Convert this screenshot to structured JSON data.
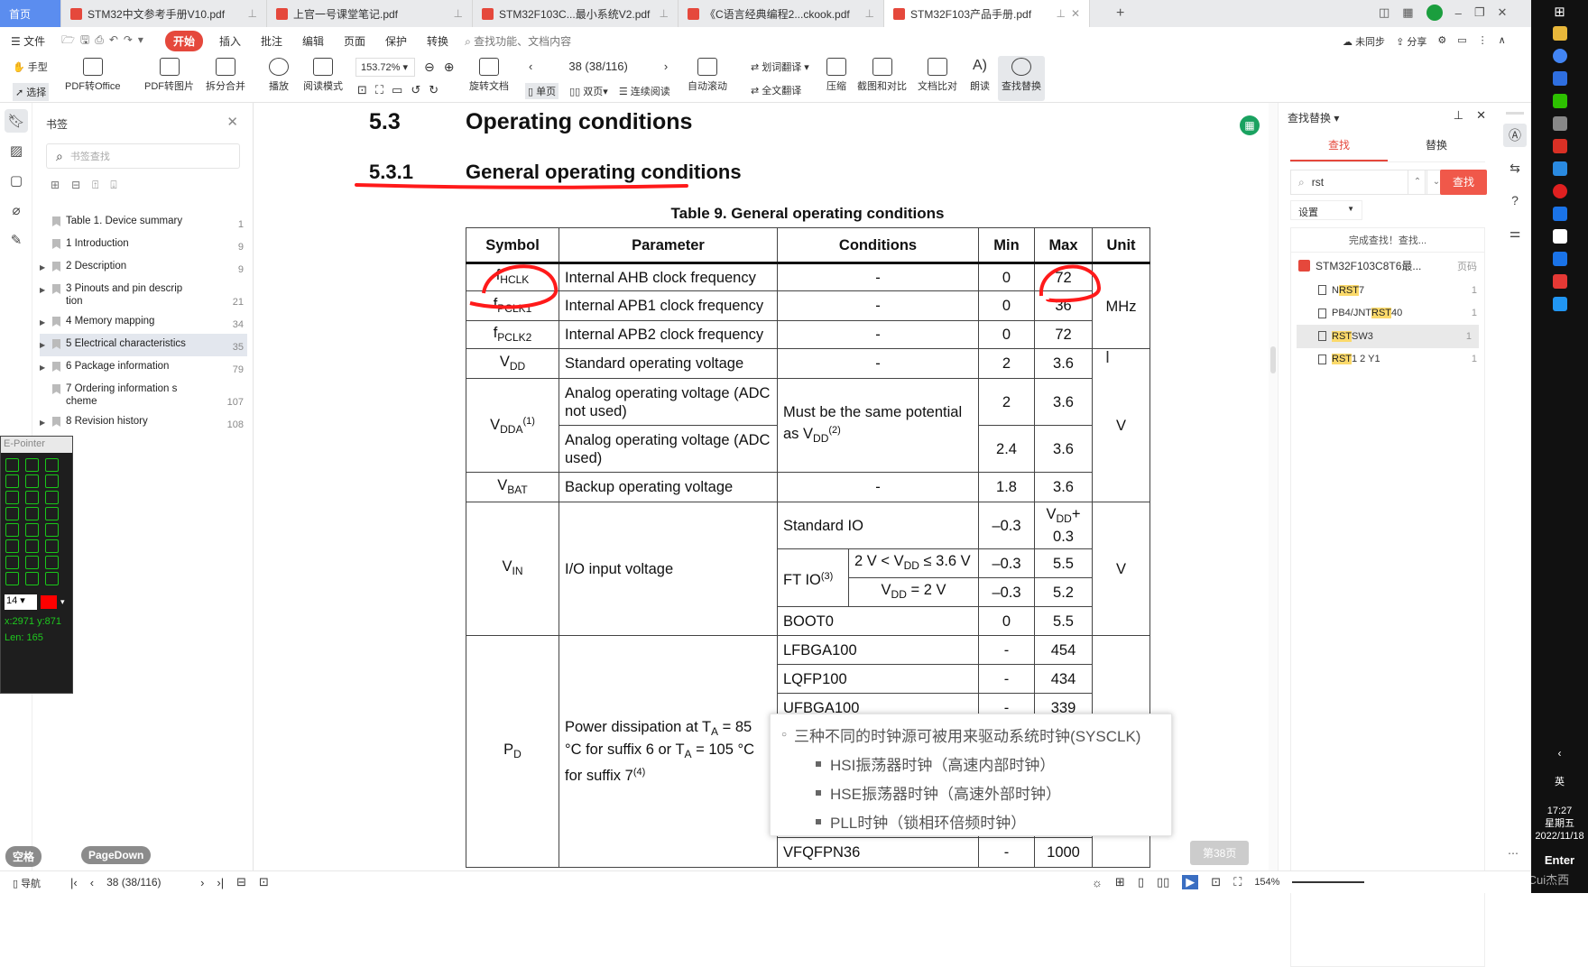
{
  "tabs": [
    {
      "label": "首页",
      "type": "home"
    },
    {
      "label": "STM32中文参考手册V10.pdf"
    },
    {
      "label": "上官一号课堂笔记.pdf"
    },
    {
      "label": "STM32F103C...最小系统V2.pdf"
    },
    {
      "label": "《C语言经典编程2...ckook.pdf"
    },
    {
      "label": "STM32F103产品手册.pdf",
      "active": true
    }
  ],
  "menu": {
    "file": "文件",
    "start": "开始",
    "items": [
      "插入",
      "批注",
      "编辑",
      "页面",
      "保护",
      "转换"
    ],
    "search_placeholder": "查找功能、文档内容",
    "sync": "未同步",
    "share": "分享"
  },
  "toolbar": {
    "hand": "手型",
    "select": "选择",
    "pdf_office": "PDF转Office",
    "pdf_image": "PDF转图片",
    "split_merge": "拆分合并",
    "play": "播放",
    "read_mode": "阅读模式",
    "zoom": "153.72%",
    "rotate": "旋转文档",
    "page": "38 (38/116)",
    "single": "单页",
    "double": "双页",
    "continuous": "连续阅读",
    "auto_scroll": "自动滚动",
    "word_translate": "划词翻译",
    "full_translate": "全文翻译",
    "compress": "压缩",
    "screenshot_compare": "截图和对比",
    "doc_compare": "文档比对",
    "read_aloud": "朗读",
    "find_replace": "查找替换"
  },
  "bookmarks": {
    "title": "书签",
    "search_placeholder": "书签查找",
    "items": [
      {
        "label": "Table 1. Device summary",
        "page": "1",
        "expandable": false
      },
      {
        "label": "1 Introduction",
        "page": "9",
        "expandable": false
      },
      {
        "label": "2 Description",
        "page": "9",
        "expandable": true
      },
      {
        "label": "3 Pinouts and pin descrip tion",
        "page": "21",
        "expandable": true
      },
      {
        "label": "4 Memory mapping",
        "page": "34",
        "expandable": true
      },
      {
        "label": "5 Electrical characteristics",
        "page": "35",
        "expandable": true,
        "selected": true
      },
      {
        "label": "6 Package information",
        "page": "79",
        "expandable": true
      },
      {
        "label": "7 Ordering information s cheme",
        "page": "107",
        "expandable": false
      },
      {
        "label": "8 Revision history",
        "page": "108",
        "expandable": true
      }
    ]
  },
  "epointer": {
    "title": "E-Pointer",
    "size": "14",
    "color": "#ff0000",
    "coords": "x:2971 y:871",
    "length": "Len: 165"
  },
  "keys": {
    "space": "空格",
    "pagedown": "PageDown"
  },
  "document": {
    "h1_num": "5.3",
    "h1": "Operating conditions",
    "h2_num": "5.3.1",
    "h2": "General operating conditions",
    "table_title": "Table 9. General operating conditions",
    "headers": [
      "Symbol",
      "Parameter",
      "Conditions",
      "Min",
      "Max",
      "Unit"
    ],
    "rows": [
      [
        {
          "p": [
            [
              "f"
            ],
            [
              "HCLK",
              "sub"
            ]
          ]
        },
        {
          "p": [
            [
              "Internal AHB clock frequency"
            ]
          ]
        },
        {
          "p": [
            [
              "-"
            ]
          ],
          "cs": 2,
          "c": 1
        },
        {
          "p": [
            [
              "0"
            ]
          ],
          "c": 1
        },
        {
          "p": [
            [
              "72"
            ]
          ],
          "c": 1
        },
        {
          "p": [
            [
              "MHz"
            ]
          ],
          "rs": 3,
          "c": 1
        }
      ],
      [
        {
          "p": [
            [
              "f"
            ],
            [
              "PCLK1",
              "sub"
            ]
          ]
        },
        {
          "p": [
            [
              "Internal APB1 clock frequency"
            ]
          ]
        },
        {
          "p": [
            [
              "-"
            ]
          ],
          "cs": 2,
          "c": 1
        },
        {
          "p": [
            [
              "0"
            ]
          ],
          "c": 1
        },
        {
          "p": [
            [
              "36"
            ]
          ],
          "c": 1
        }
      ],
      [
        {
          "p": [
            [
              "f"
            ],
            [
              "PCLK2",
              "sub"
            ]
          ]
        },
        {
          "p": [
            [
              "Internal APB2 clock frequency"
            ]
          ]
        },
        {
          "p": [
            [
              "-"
            ]
          ],
          "cs": 2,
          "c": 1
        },
        {
          "p": [
            [
              "0"
            ]
          ],
          "c": 1
        },
        {
          "p": [
            [
              "72"
            ]
          ],
          "c": 1
        }
      ],
      [
        {
          "p": [
            [
              "V"
            ],
            [
              "DD",
              "sub"
            ]
          ]
        },
        {
          "p": [
            [
              "Standard operating voltage"
            ]
          ]
        },
        {
          "p": [
            [
              "-"
            ]
          ],
          "cs": 2,
          "c": 1
        },
        {
          "p": [
            [
              "2"
            ]
          ],
          "c": 1
        },
        {
          "p": [
            [
              "3.6"
            ]
          ],
          "c": 1
        },
        {
          "p": [
            [
              "V"
            ]
          ],
          "rs": 4,
          "c": 1
        }
      ],
      [
        {
          "p": [
            [
              "V"
            ],
            [
              "DDA",
              "sub"
            ],
            [
              "(1)",
              "sup"
            ]
          ],
          "rs": 2
        },
        {
          "p": [
            [
              "Analog operating voltage (ADC not used)"
            ]
          ]
        },
        {
          "p": [
            [
              "Must be the same potential as V"
            ],
            [
              "DD",
              "sub"
            ],
            [
              "(2)",
              "sup"
            ]
          ],
          "cs": 2,
          "rs": 2
        },
        {
          "p": [
            [
              "2"
            ]
          ],
          "c": 1
        },
        {
          "p": [
            [
              "3.6"
            ]
          ],
          "c": 1
        }
      ],
      [
        {
          "p": [
            [
              "Analog operating voltage (ADC used)"
            ]
          ]
        },
        {
          "p": [
            [
              "2.4"
            ]
          ],
          "c": 1
        },
        {
          "p": [
            [
              "3.6"
            ]
          ],
          "c": 1
        }
      ],
      [
        {
          "p": [
            [
              "V"
            ],
            [
              "BAT",
              "sub"
            ]
          ]
        },
        {
          "p": [
            [
              "Backup operating voltage"
            ]
          ]
        },
        {
          "p": [
            [
              "-"
            ]
          ],
          "cs": 2,
          "c": 1
        },
        {
          "p": [
            [
              "1.8"
            ]
          ],
          "c": 1
        },
        {
          "p": [
            [
              "3.6"
            ]
          ],
          "c": 1
        }
      ],
      [
        {
          "p": [
            [
              "V"
            ],
            [
              "IN",
              "sub"
            ]
          ],
          "rs": 4
        },
        {
          "p": [
            [
              "I/O input voltage"
            ]
          ],
          "rs": 4
        },
        {
          "p": [
            [
              "Standard IO"
            ]
          ],
          "cs": 2
        },
        {
          "p": [
            [
              "–0.3"
            ]
          ],
          "c": 1
        },
        {
          "p": [
            [
              "V"
            ],
            [
              "DD",
              "sub"
            ],
            [
              "+ 0.3"
            ]
          ],
          "c": 1
        },
        {
          "p": [
            [
              "V"
            ]
          ],
          "rs": 4,
          "c": 1
        }
      ],
      [
        {
          "p": [
            [
              "FT IO"
            ],
            [
              "(3)",
              "sup"
            ]
          ],
          "rs": 2
        },
        {
          "p": [
            [
              "2 V < V"
            ],
            [
              "DD",
              "sub"
            ],
            [
              " ≤  3.6 V"
            ]
          ]
        },
        {
          "p": [
            [
              "–0.3"
            ]
          ],
          "c": 1
        },
        {
          "p": [
            [
              "5.5"
            ]
          ],
          "c": 1
        }
      ],
      [
        {
          "p": [
            [
              "V"
            ],
            [
              "DD",
              "sub"
            ],
            [
              " = 2 V"
            ]
          ]
        },
        {
          "p": [
            [
              "–0.3"
            ]
          ],
          "c": 1
        },
        {
          "p": [
            [
              "5.2"
            ]
          ],
          "c": 1
        }
      ],
      [
        {
          "p": [
            [
              "BOOT0"
            ]
          ],
          "cs": 2
        },
        {
          "p": [
            [
              "0"
            ]
          ],
          "c": 1
        },
        {
          "p": [
            [
              "5.5"
            ]
          ],
          "c": 1
        }
      ],
      [
        {
          "p": [
            [
              "P"
            ],
            [
              "D",
              "sub"
            ]
          ],
          "rs": 9
        },
        {
          "p": [
            [
              "Power dissipation at T"
            ],
            [
              "A",
              "sub"
            ],
            [
              " = 85 °C for suffix 6 or T"
            ],
            [
              "A",
              "sub"
            ],
            [
              " = 105 °C for suffix 7"
            ],
            [
              "(4)",
              "sup"
            ]
          ],
          "rs": 9
        },
        {
          "p": [
            [
              "LFBGA100"
            ]
          ],
          "cs": 2
        },
        {
          "p": [
            [
              "-"
            ]
          ],
          "c": 1
        },
        {
          "p": [
            [
              "454"
            ]
          ],
          "c": 1
        },
        {
          "p": [
            [
              ""
            ]
          ],
          "rs": 9
        }
      ],
      [
        {
          "p": [
            [
              "LQFP100"
            ]
          ],
          "cs": 2
        },
        {
          "p": [
            [
              "-"
            ]
          ],
          "c": 1
        },
        {
          "p": [
            [
              "434"
            ]
          ],
          "c": 1
        }
      ],
      [
        {
          "p": [
            [
              "UFBGA100"
            ]
          ],
          "cs": 2
        },
        {
          "p": [
            [
              "-"
            ]
          ],
          "c": 1
        },
        {
          "p": [
            [
              "339"
            ]
          ],
          "c": 1
        }
      ],
      [
        {
          "p": [
            [
              ""
            ]
          ],
          "cs": 2
        },
        {
          "p": [
            [
              ""
            ]
          ]
        },
        {
          "p": [
            [
              ""
            ]
          ]
        }
      ],
      [
        {
          "p": [
            [
              ""
            ]
          ],
          "cs": 2
        },
        {
          "p": [
            [
              ""
            ]
          ]
        },
        {
          "p": [
            [
              ""
            ]
          ]
        }
      ],
      [
        {
          "p": [
            [
              ""
            ]
          ],
          "cs": 2
        },
        {
          "p": [
            [
              ""
            ]
          ]
        },
        {
          "p": [
            [
              ""
            ]
          ]
        }
      ],
      [
        {
          "p": [
            [
              ""
            ]
          ],
          "cs": 2
        },
        {
          "p": [
            [
              ""
            ]
          ]
        },
        {
          "p": [
            [
              ""
            ]
          ]
        }
      ],
      [
        {
          "p": [
            [
              "VFQFPN36"
            ]
          ],
          "cs": 2
        },
        {
          "p": [
            [
              "-"
            ]
          ],
          "c": 1
        },
        {
          "p": [
            [
              "1000"
            ]
          ],
          "c": 1
        }
      ]
    ],
    "page_badge": "第38页"
  },
  "popup": {
    "main": "三种不同的时钟源可被用来驱动系统时钟(SYSCLK)",
    "items": [
      "HSI振荡器时钟（高速内部时钟）",
      "HSE振荡器时钟（高速外部时钟）",
      "PLL时钟（锁相环倍频时钟）"
    ]
  },
  "find": {
    "title": "查找替换",
    "tab_find": "查找",
    "tab_replace": "替换",
    "query": "rst",
    "button": "查找",
    "settings": "设置",
    "status": "完成查找！查找...",
    "doc": "STM32F103C8T6最...",
    "page_col": "页码",
    "results": [
      {
        "pre": "N",
        "hit": "RST",
        "post": "7",
        "page": "1"
      },
      {
        "pre": "PB4/JNT",
        "hit": "RST",
        "post": "40",
        "page": "1"
      },
      {
        "pre": "",
        "hit": "RST",
        "post": "SW3",
        "page": "1",
        "selected": true
      },
      {
        "pre": "",
        "hit": "RST",
        "post": "1 2 Y1",
        "page": "1"
      }
    ]
  },
  "status": {
    "nav": "导航",
    "page": "38 (38/116)",
    "zoom": "154%"
  },
  "taskbar": {
    "time": "17:27",
    "weekday": "星期五",
    "date": "2022/11/18",
    "ime": "英",
    "enter_key": "Enter",
    "watermark": "CSDN @Cui杰西"
  },
  "colors": {
    "accent": "#e5483c",
    "home_tab": "#5b8def",
    "annotation": "#ff1a1a",
    "epointer_green": "#19c719"
  }
}
